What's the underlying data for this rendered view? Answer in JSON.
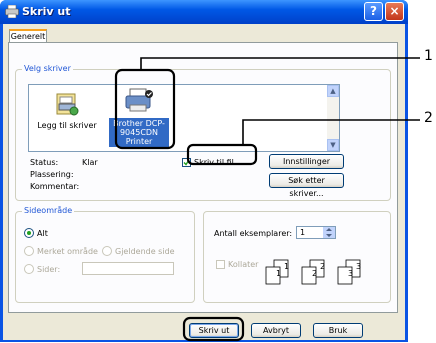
{
  "window": {
    "title": "Skriv ut",
    "help_glyph": "?",
    "close_glyph": "×"
  },
  "tabs": [
    {
      "label": "Generelt"
    }
  ],
  "select_printer": {
    "legend": "Velg skriver",
    "items": [
      {
        "label": "Legg til skriver",
        "icon": "add-printer-icon"
      },
      {
        "label": "Brother DCP-9045CDN Printer",
        "icon": "printer-icon",
        "selected": true
      }
    ],
    "scroll_up": "▲",
    "scroll_down": "▼"
  },
  "printer_info": {
    "status_label": "Status:",
    "status_value": "Klar",
    "location_label": "Plassering:",
    "comment_label": "Kommentar:"
  },
  "print_to_file": {
    "label": "Skriv til fil",
    "checked": true
  },
  "buttons": {
    "preferences": "Innstillinger",
    "find_printer": "Søk etter skriver...",
    "print": "Skriv ut",
    "cancel": "Avbryt",
    "apply": "Bruk"
  },
  "page_range": {
    "legend": "Sideområde",
    "all": "Alt",
    "selection": "Merket område",
    "current_page": "Gjeldende side",
    "pages": "Sider:",
    "pages_value": ""
  },
  "copies": {
    "label": "Antall eksemplarer:",
    "value": "1",
    "collate_label": "Kollater",
    "collate_checked": false,
    "page_numbers": [
      "1",
      "1",
      "2",
      "2",
      "3",
      "3"
    ]
  },
  "callouts": [
    "1",
    "2"
  ],
  "colors": {
    "title_bar": "#0058e6",
    "dialog_bg": "#ece9d8",
    "legend_text": "#2157d6",
    "callout": "#000000"
  }
}
